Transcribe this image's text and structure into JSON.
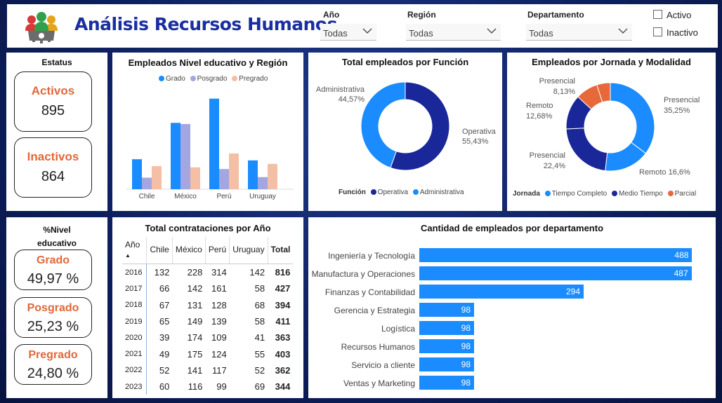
{
  "header": {
    "title": "Análisis Recursos Humanos",
    "logo_icon": "team-gear-icon",
    "filters": [
      {
        "label": "Año",
        "value": "Todas"
      },
      {
        "label": "Región",
        "value": "Todas"
      },
      {
        "label": "Departamento",
        "value": "Todas"
      }
    ],
    "checkboxes": [
      {
        "label": "Activo",
        "checked": false
      },
      {
        "label": "Inactivo",
        "checked": false
      }
    ]
  },
  "status": {
    "title": "Estatus",
    "items": [
      {
        "label": "Activos",
        "value": "895"
      },
      {
        "label": "Inactivos",
        "value": "864"
      }
    ]
  },
  "education": {
    "title": "%Nivel educativo",
    "items": [
      {
        "label": "Grado",
        "value": "49,97 %"
      },
      {
        "label": "Posgrado",
        "value": "25,23 %"
      },
      {
        "label": "Pregrado",
        "value": "24,80 %"
      }
    ]
  },
  "colors": {
    "blue": "#1a8cff",
    "lavender": "#a3a6e0",
    "peach": "#f4bfa4",
    "navy": "#1a2799",
    "orange": "#e8683a",
    "title": "#1a2ea0"
  },
  "chart_data": [
    {
      "type": "bar",
      "title": "Empleados Nivel educativo y Región",
      "categories": [
        "Chile",
        "México",
        "Perú",
        "Uruguay"
      ],
      "series": [
        {
          "name": "Grado",
          "values": [
            52,
            115,
            157,
            50
          ]
        },
        {
          "name": "Posgrado",
          "values": [
            20,
            113,
            35,
            21
          ]
        },
        {
          "name": "Pregrado",
          "values": [
            40,
            38,
            62,
            44
          ]
        }
      ],
      "ylim": [
        0,
        170
      ],
      "legend": "top"
    },
    {
      "type": "pie",
      "title": "Total empleados por Función",
      "legend_title": "Función",
      "labels": [
        "Operativa",
        "Administrativa"
      ],
      "values": [
        55.43,
        44.57
      ],
      "value_labels": [
        "55,43%",
        "44,57%"
      ],
      "legend": "bottom"
    },
    {
      "type": "pie",
      "title": "Empleados por Jornada y Modalidad",
      "legend_title": "Jornada",
      "legend_items": [
        "Tiempo Completo",
        "Medio Tiempo",
        "Parcial"
      ],
      "slices": [
        {
          "jornada": "Tiempo Completo",
          "modalidad": "Presencial",
          "value": 35.25,
          "label": "35,25%"
        },
        {
          "jornada": "Tiempo Completo",
          "modalidad": "Remoto",
          "value": 16.6,
          "label": "16,6%"
        },
        {
          "jornada": "Medio Tiempo",
          "modalidad": "Presencial",
          "value": 22.4,
          "label": "22,4%"
        },
        {
          "jornada": "Medio Tiempo",
          "modalidad": "Remoto",
          "value": 12.68,
          "label": "12,68%"
        },
        {
          "jornada": "Parcial",
          "modalidad": "Presencial",
          "value": 8.13,
          "label": "8,13%"
        },
        {
          "jornada": "Parcial",
          "modalidad": "Remoto",
          "value": 4.94,
          "label": ""
        }
      ],
      "legend": "bottom"
    },
    {
      "type": "table",
      "title": "Total contrataciones por Año",
      "columns": [
        "Año",
        "Chile",
        "México",
        "Perú",
        "Uruguay",
        "Total"
      ],
      "rows": [
        [
          "2016",
          "132",
          "228",
          "314",
          "142",
          "816"
        ],
        [
          "2017",
          "66",
          "142",
          "161",
          "58",
          "427"
        ],
        [
          "2018",
          "67",
          "131",
          "128",
          "68",
          "394"
        ],
        [
          "2019",
          "65",
          "149",
          "139",
          "58",
          "411"
        ],
        [
          "2020",
          "39",
          "174",
          "109",
          "41",
          "363"
        ],
        [
          "2021",
          "49",
          "175",
          "124",
          "55",
          "403"
        ],
        [
          "2022",
          "52",
          "141",
          "117",
          "52",
          "362"
        ],
        [
          "2023",
          "60",
          "116",
          "99",
          "69",
          "344"
        ]
      ]
    },
    {
      "type": "bar",
      "orientation": "horizontal",
      "title": "Cantidad de empleados por departamento",
      "categories": [
        "Ingeniería y Tecnología",
        "Manufactura y Operaciones",
        "Finanzas y Contabilidad",
        "Gerencia y Estrategia",
        "Logística",
        "Recursos Humanos",
        "Servicio a cliente",
        "Ventas y Marketing"
      ],
      "values": [
        488,
        487,
        294,
        98,
        98,
        98,
        98,
        98
      ]
    }
  ]
}
